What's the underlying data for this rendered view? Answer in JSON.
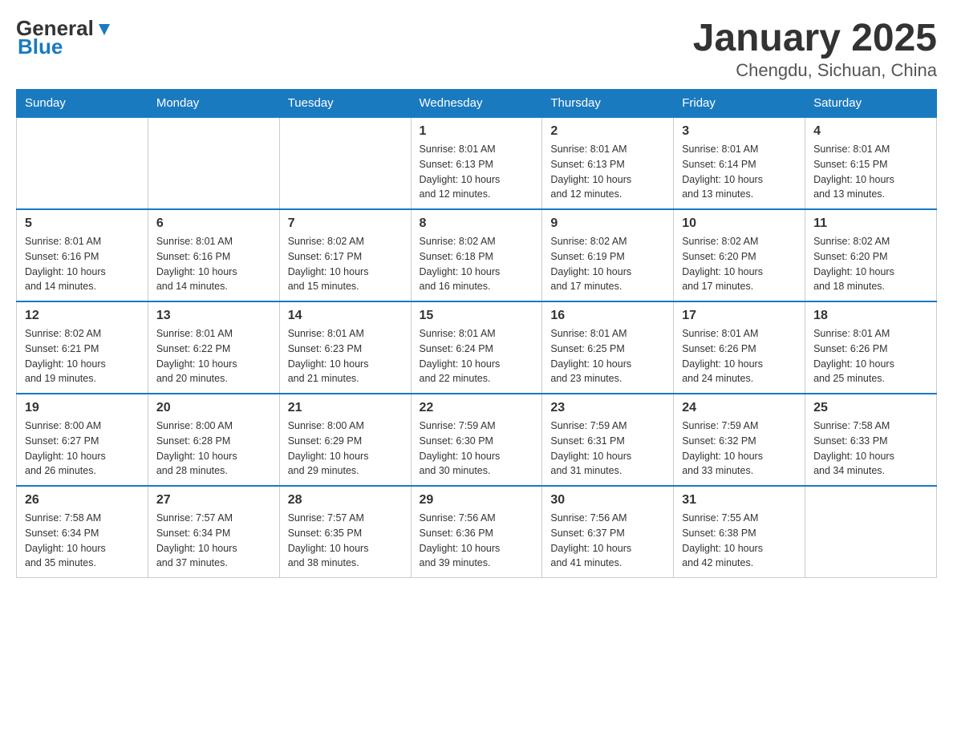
{
  "header": {
    "logo_general": "General",
    "logo_blue": "Blue",
    "title": "January 2025",
    "subtitle": "Chengdu, Sichuan, China"
  },
  "weekdays": [
    "Sunday",
    "Monday",
    "Tuesday",
    "Wednesday",
    "Thursday",
    "Friday",
    "Saturday"
  ],
  "weeks": [
    [
      {
        "day": "",
        "info": ""
      },
      {
        "day": "",
        "info": ""
      },
      {
        "day": "",
        "info": ""
      },
      {
        "day": "1",
        "info": "Sunrise: 8:01 AM\nSunset: 6:13 PM\nDaylight: 10 hours\nand 12 minutes."
      },
      {
        "day": "2",
        "info": "Sunrise: 8:01 AM\nSunset: 6:13 PM\nDaylight: 10 hours\nand 12 minutes."
      },
      {
        "day": "3",
        "info": "Sunrise: 8:01 AM\nSunset: 6:14 PM\nDaylight: 10 hours\nand 13 minutes."
      },
      {
        "day": "4",
        "info": "Sunrise: 8:01 AM\nSunset: 6:15 PM\nDaylight: 10 hours\nand 13 minutes."
      }
    ],
    [
      {
        "day": "5",
        "info": "Sunrise: 8:01 AM\nSunset: 6:16 PM\nDaylight: 10 hours\nand 14 minutes."
      },
      {
        "day": "6",
        "info": "Sunrise: 8:01 AM\nSunset: 6:16 PM\nDaylight: 10 hours\nand 14 minutes."
      },
      {
        "day": "7",
        "info": "Sunrise: 8:02 AM\nSunset: 6:17 PM\nDaylight: 10 hours\nand 15 minutes."
      },
      {
        "day": "8",
        "info": "Sunrise: 8:02 AM\nSunset: 6:18 PM\nDaylight: 10 hours\nand 16 minutes."
      },
      {
        "day": "9",
        "info": "Sunrise: 8:02 AM\nSunset: 6:19 PM\nDaylight: 10 hours\nand 17 minutes."
      },
      {
        "day": "10",
        "info": "Sunrise: 8:02 AM\nSunset: 6:20 PM\nDaylight: 10 hours\nand 17 minutes."
      },
      {
        "day": "11",
        "info": "Sunrise: 8:02 AM\nSunset: 6:20 PM\nDaylight: 10 hours\nand 18 minutes."
      }
    ],
    [
      {
        "day": "12",
        "info": "Sunrise: 8:02 AM\nSunset: 6:21 PM\nDaylight: 10 hours\nand 19 minutes."
      },
      {
        "day": "13",
        "info": "Sunrise: 8:01 AM\nSunset: 6:22 PM\nDaylight: 10 hours\nand 20 minutes."
      },
      {
        "day": "14",
        "info": "Sunrise: 8:01 AM\nSunset: 6:23 PM\nDaylight: 10 hours\nand 21 minutes."
      },
      {
        "day": "15",
        "info": "Sunrise: 8:01 AM\nSunset: 6:24 PM\nDaylight: 10 hours\nand 22 minutes."
      },
      {
        "day": "16",
        "info": "Sunrise: 8:01 AM\nSunset: 6:25 PM\nDaylight: 10 hours\nand 23 minutes."
      },
      {
        "day": "17",
        "info": "Sunrise: 8:01 AM\nSunset: 6:26 PM\nDaylight: 10 hours\nand 24 minutes."
      },
      {
        "day": "18",
        "info": "Sunrise: 8:01 AM\nSunset: 6:26 PM\nDaylight: 10 hours\nand 25 minutes."
      }
    ],
    [
      {
        "day": "19",
        "info": "Sunrise: 8:00 AM\nSunset: 6:27 PM\nDaylight: 10 hours\nand 26 minutes."
      },
      {
        "day": "20",
        "info": "Sunrise: 8:00 AM\nSunset: 6:28 PM\nDaylight: 10 hours\nand 28 minutes."
      },
      {
        "day": "21",
        "info": "Sunrise: 8:00 AM\nSunset: 6:29 PM\nDaylight: 10 hours\nand 29 minutes."
      },
      {
        "day": "22",
        "info": "Sunrise: 7:59 AM\nSunset: 6:30 PM\nDaylight: 10 hours\nand 30 minutes."
      },
      {
        "day": "23",
        "info": "Sunrise: 7:59 AM\nSunset: 6:31 PM\nDaylight: 10 hours\nand 31 minutes."
      },
      {
        "day": "24",
        "info": "Sunrise: 7:59 AM\nSunset: 6:32 PM\nDaylight: 10 hours\nand 33 minutes."
      },
      {
        "day": "25",
        "info": "Sunrise: 7:58 AM\nSunset: 6:33 PM\nDaylight: 10 hours\nand 34 minutes."
      }
    ],
    [
      {
        "day": "26",
        "info": "Sunrise: 7:58 AM\nSunset: 6:34 PM\nDaylight: 10 hours\nand 35 minutes."
      },
      {
        "day": "27",
        "info": "Sunrise: 7:57 AM\nSunset: 6:34 PM\nDaylight: 10 hours\nand 37 minutes."
      },
      {
        "day": "28",
        "info": "Sunrise: 7:57 AM\nSunset: 6:35 PM\nDaylight: 10 hours\nand 38 minutes."
      },
      {
        "day": "29",
        "info": "Sunrise: 7:56 AM\nSunset: 6:36 PM\nDaylight: 10 hours\nand 39 minutes."
      },
      {
        "day": "30",
        "info": "Sunrise: 7:56 AM\nSunset: 6:37 PM\nDaylight: 10 hours\nand 41 minutes."
      },
      {
        "day": "31",
        "info": "Sunrise: 7:55 AM\nSunset: 6:38 PM\nDaylight: 10 hours\nand 42 minutes."
      },
      {
        "day": "",
        "info": ""
      }
    ]
  ]
}
